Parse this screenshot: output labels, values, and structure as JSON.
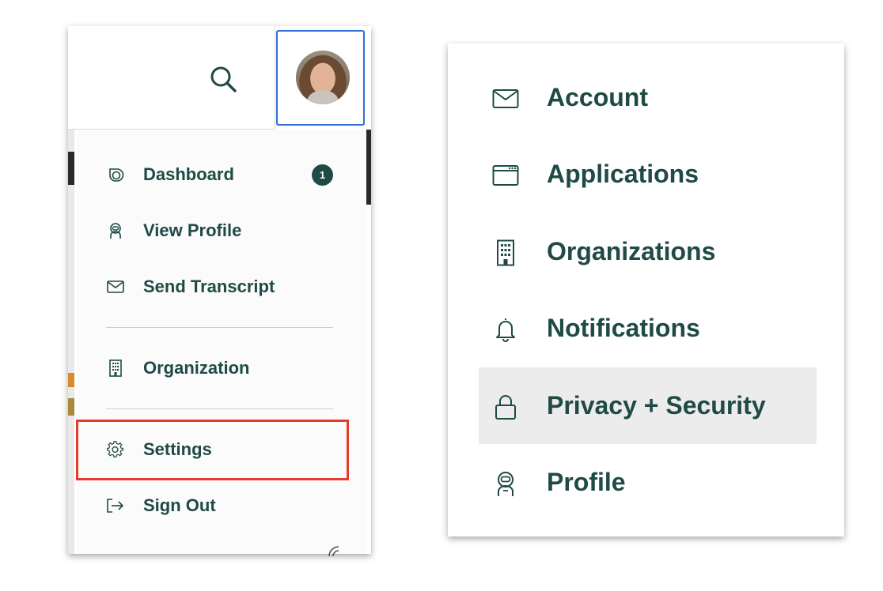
{
  "left_menu": {
    "items": [
      {
        "id": "dashboard",
        "label": "Dashboard",
        "icon": "dashboard-icon",
        "badge": "1"
      },
      {
        "id": "view-profile",
        "label": "View Profile",
        "icon": "astronaut-icon"
      },
      {
        "id": "send-transcript",
        "label": "Send Transcript",
        "icon": "envelope-icon"
      },
      {
        "id": "organization",
        "label": "Organization",
        "icon": "building-icon"
      },
      {
        "id": "settings",
        "label": "Settings",
        "icon": "gear-icon"
      },
      {
        "id": "sign-out",
        "label": "Sign Out",
        "icon": "sign-out-icon"
      }
    ]
  },
  "settings_menu": {
    "items": [
      {
        "id": "account",
        "label": "Account",
        "icon": "envelope-icon"
      },
      {
        "id": "applications",
        "label": "Applications",
        "icon": "browser-window-icon"
      },
      {
        "id": "organizations",
        "label": "Organizations",
        "icon": "building-icon"
      },
      {
        "id": "notifications",
        "label": "Notifications",
        "icon": "bell-icon"
      },
      {
        "id": "privacy-security",
        "label": "Privacy + Security",
        "icon": "lock-icon",
        "active": true
      },
      {
        "id": "profile",
        "label": "Profile",
        "icon": "astronaut-icon"
      }
    ]
  },
  "colors": {
    "text_primary": "#1f4a45",
    "focus_outline": "#2f6fd6",
    "highlight_outline": "#e53c2e",
    "active_row_bg": "#ececec"
  }
}
